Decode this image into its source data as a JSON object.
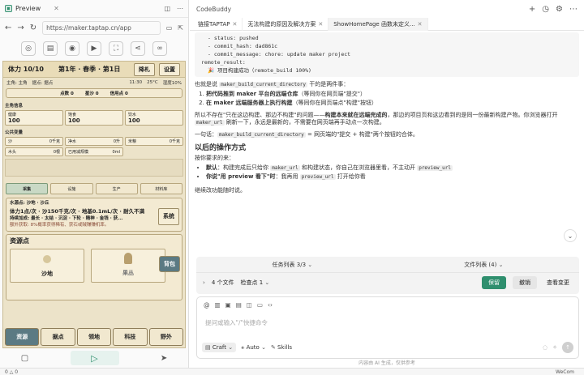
{
  "preview": {
    "tab_label": "Preview",
    "url": "https://maker.taptap.cn/app"
  },
  "game": {
    "header": {
      "vitality": "体力 10/10",
      "season": "第1年 · 春季 · 第1日",
      "diary_btn": "降札",
      "settings_btn": "设置"
    },
    "status": {
      "host": "主角: 主角",
      "location": "据点: 据点",
      "time": "11:30",
      "temp": "25°C",
      "humidity": "湿度10%"
    },
    "points": {
      "label1": "点数 0",
      "label2": "星沙 0",
      "label3": "信用点 0"
    },
    "host_info": {
      "title": "主角信息",
      "cells": [
        {
          "label": "健康",
          "value": "100"
        },
        {
          "label": "饱食",
          "value": "100"
        },
        {
          "label": "饮水",
          "value": "100"
        }
      ]
    },
    "public": {
      "title": "公共变量",
      "rows": [
        [
          "沙",
          "0千克",
          "净水",
          "0升",
          "米粮",
          "0千克"
        ],
        [
          "木头",
          "0根",
          "已用减规模",
          "0ml",
          "",
          ""
        ]
      ]
    },
    "tabs": [
      "采集",
      "设施",
      "生产",
      "材料库"
    ],
    "notice": {
      "line1": "水源点: 沙地 · 沙丘",
      "line2": "体力1点/次 · 沙150千克/次 · 地基0.1mL/次 · 耐久不满",
      "line3": "持续加成: 最长 · 太结 · 沉淀 · 下轮 · 精神 · 金钱 · 获...",
      "line4": "额外获取: 8%概率获得稀有、获石或贼赚赚机率。",
      "side_btn1": "系统",
      "side_btn2": "背包"
    },
    "resource": {
      "title": "资源点",
      "items": [
        "沙地",
        "果丛"
      ]
    },
    "nav": [
      "资源",
      "据点",
      "领地",
      "科技",
      "野外"
    ]
  },
  "codebuddy": {
    "title": "CodeBuddy",
    "tabs": [
      "链接TAPTAP",
      "无法构建的原因及解决方案",
      "ShowHomePage 函数未定义..."
    ],
    "code": [
      "- status: pushed",
      "- commit_hash: dad861c",
      "- commit_message: chore: update maker project",
      "remote_result:",
      "🎉 项目构建成功（remote_build 100%)"
    ],
    "p1a": "也就是说 ",
    "p1code": "maker_build_current_directory",
    "p1b": " 干的是两件事：",
    "ol": [
      {
        "b": "把代码推到 maker 平台的远端仓库",
        "t": "（等同你在网页端\"提交\"）"
      },
      {
        "b": "在 maker 远端服务器上执行构建",
        "t": "（等同你在网页端点\"构建\"按钮）"
      }
    ],
    "p2a": "所以不存在\"只在这边构建、那边不构建\"的问题——",
    "p2b": "构建本来就在远端完成的",
    "p2c": "，那边的项目页和这边看到的是同一份最新构建产物。你浏览器打开 ",
    "p2code": "maker_url",
    "p2d": " 刷新一下，永远是最新的，不需要在网页端再手动点一次构建。",
    "p3a": "一句话：",
    "p3code": "maker_build_current_directory",
    "p3b": " = 网页端的\"提交 + 构建\"两个按钮的合体。",
    "h3": "以后的操作方式",
    "p4": "按你要求的来：",
    "ul": [
      {
        "b": "默认",
        "t": "：构建完成后只给你 ",
        "c": "maker_url",
        "t2": " 和构建状态，你自己在浏览器里看，不主动开 ",
        "c2": "preview_url"
      },
      {
        "b": "你说\"用 preview 看下\"时",
        "t": "：我再用 ",
        "c": "preview_url",
        "t2": " 打开给你看",
        "c2": ""
      }
    ],
    "p5": "继续改功能随时说。",
    "taskbar": {
      "tasks": "任务列表 3/3",
      "files": "文件列表 (4)",
      "files_count": "4 个文件",
      "check": "检查点 1",
      "keep": "保留",
      "undo": "撤销",
      "review": "查看变更"
    },
    "input": {
      "placeholder": "提问或输入\"/\"快捷命令",
      "mode": "Craft",
      "model": "Auto",
      "skills": "Skills"
    },
    "footer": "内容由 AI 生成，仅供参考"
  },
  "statusbar": {
    "left": "0 △ 0",
    "right": "WeCom"
  }
}
